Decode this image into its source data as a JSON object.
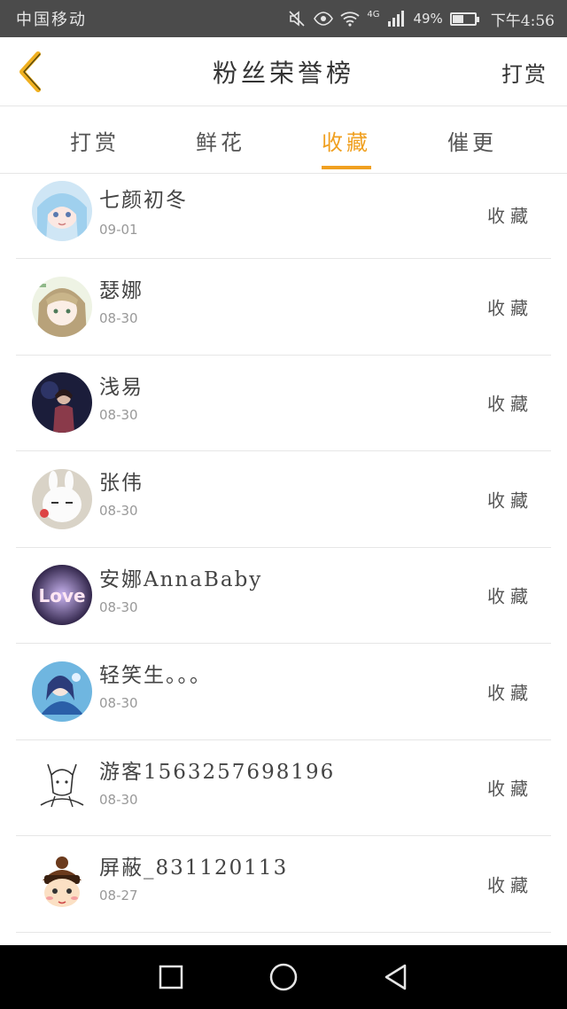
{
  "status_bar": {
    "carrier": "中国移动",
    "network": "4G",
    "battery_percent": "49%",
    "battery_level": 0.49,
    "time": "下午4:56",
    "icons": [
      "mute-icon",
      "eye-icon",
      "wifi-icon",
      "signal-icon",
      "battery-icon"
    ]
  },
  "nav": {
    "title": "粉丝荣誉榜",
    "action_label": "打赏",
    "back_icon": "chevron-left-icon",
    "accent_color": "#f0a020"
  },
  "tabs": [
    {
      "label": "打赏",
      "active": false
    },
    {
      "label": "鲜花",
      "active": false
    },
    {
      "label": "收藏",
      "active": true
    },
    {
      "label": "催更",
      "active": false
    }
  ],
  "list": [
    {
      "name": "七颜初冬",
      "date": "09-01",
      "action": "收藏",
      "avatar": "anime-girl-blue-avatar"
    },
    {
      "name": "瑟娜",
      "date": "08-30",
      "action": "收藏",
      "avatar": "anime-girl-green-avatar"
    },
    {
      "name": "浅易",
      "date": "08-30",
      "action": "收藏",
      "avatar": "dark-figure-avatar"
    },
    {
      "name": "张伟",
      "date": "08-30",
      "action": "收藏",
      "avatar": "white-rabbit-avatar"
    },
    {
      "name": "安娜AnnaBaby",
      "date": "08-30",
      "action": "收藏",
      "avatar": "love-text-avatar"
    },
    {
      "name": "轻笑生。。。",
      "date": "08-30",
      "action": "收藏",
      "avatar": "blue-fairy-avatar"
    },
    {
      "name": "游客1563257698196",
      "date": "08-30",
      "action": "收藏",
      "avatar": "sketch-animal-avatar"
    },
    {
      "name": "屏蔽_831120113",
      "date": "08-27",
      "action": "收藏",
      "avatar": "cartoon-kid-avatar"
    }
  ],
  "system_nav": {
    "buttons": [
      "recent-apps-icon",
      "home-icon",
      "back-triangle-icon"
    ]
  }
}
